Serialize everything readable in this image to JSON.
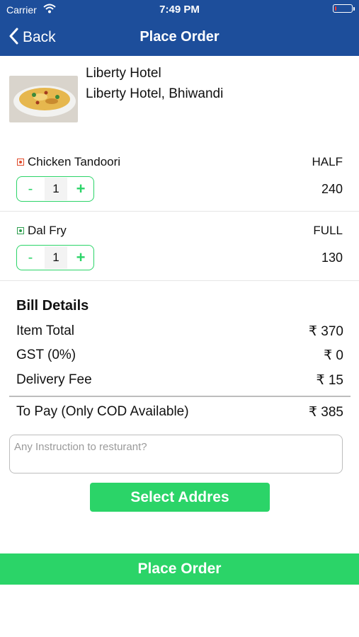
{
  "status_bar": {
    "carrier": "Carrier",
    "time": "7:49 PM",
    "battery_level": 0.1,
    "battery_color": "#ff3b30"
  },
  "nav": {
    "back_label": "Back",
    "title": "Place Order",
    "color": "#1d4e9b"
  },
  "hotel": {
    "name": "Liberty Hotel",
    "address": "Liberty Hotel, Bhiwandi"
  },
  "items": [
    {
      "name": "Chicken Tandoori",
      "portion": "HALF",
      "quantity": "1",
      "price": "240",
      "diet": "non-veg",
      "mark_color": "#e04a2a"
    },
    {
      "name": "Dal Fry",
      "portion": "FULL",
      "quantity": "1",
      "price": "130",
      "diet": "veg",
      "mark_color": "#2e9e4f"
    }
  ],
  "stepper": {
    "minus": "-",
    "plus": "+"
  },
  "bill": {
    "title": "Bill Details",
    "item_total_label": "Item Total",
    "item_total_value": "₹ 370",
    "gst_label": "GST (0%)",
    "gst_value": "₹ 0",
    "delivery_label": "Delivery Fee",
    "delivery_value": "₹ 15",
    "to_pay_label": "To Pay (Only COD Available)",
    "to_pay_value": "₹ 385"
  },
  "instruction": {
    "placeholder": "Any Instruction to resturant?",
    "value": ""
  },
  "buttons": {
    "select_address": "Select Addres",
    "place_order": "Place Order"
  },
  "accent": "#2bd468"
}
